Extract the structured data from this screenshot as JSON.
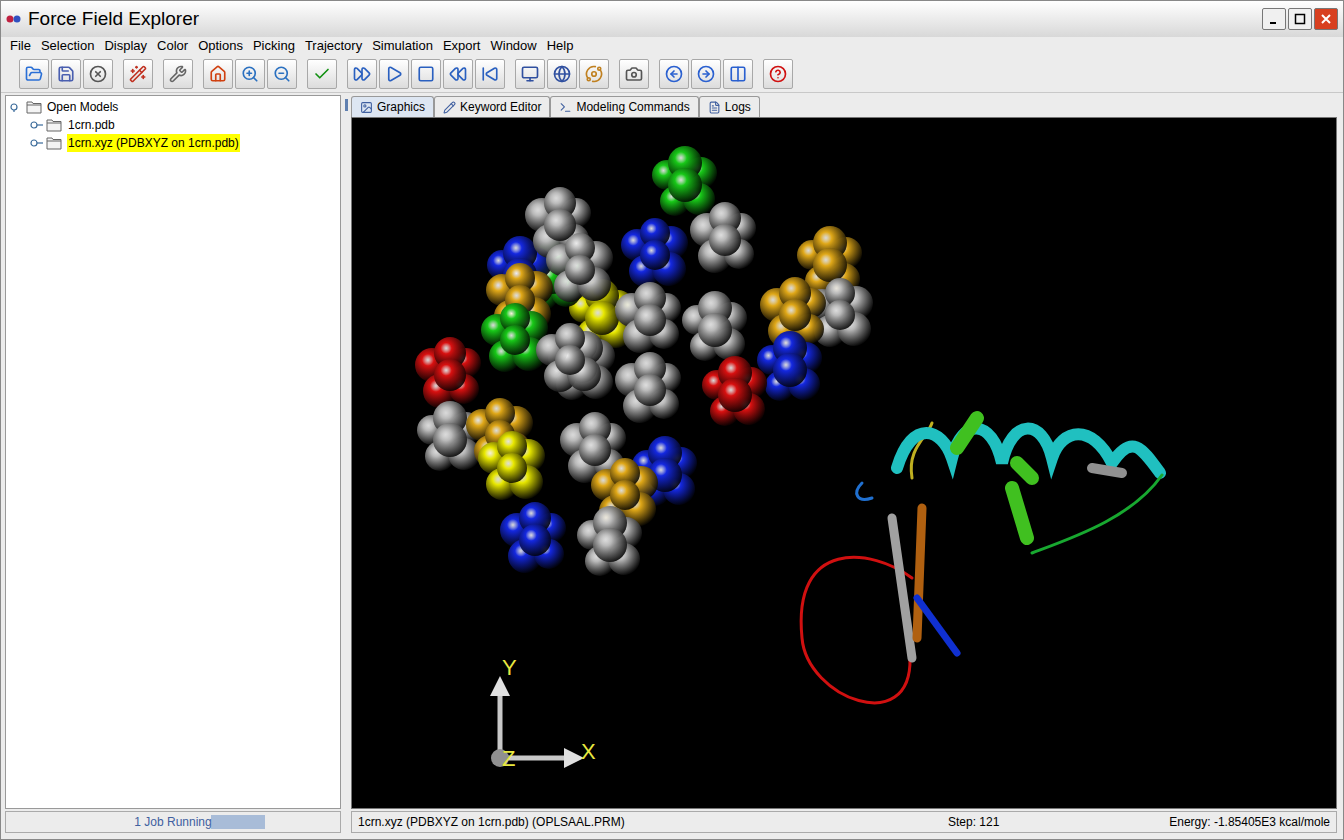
{
  "window": {
    "title": "Force Field Explorer"
  },
  "menu": [
    "File",
    "Selection",
    "Display",
    "Color",
    "Options",
    "Picking",
    "Trajectory",
    "Simulation",
    "Export",
    "Window",
    "Help"
  ],
  "tree": {
    "root": {
      "label": "Open Models",
      "expanded": true
    },
    "items": [
      {
        "label": "1crn.pdb",
        "selected": false,
        "expanded": false
      },
      {
        "label": "1crn.xyz (PDBXYZ on 1crn.pdb)",
        "selected": true,
        "expanded": false
      }
    ]
  },
  "job_status": {
    "label": "1 Job Running",
    "busy": true
  },
  "tabs": [
    {
      "label": "Graphics",
      "selected": true
    },
    {
      "label": "Keyword Editor",
      "selected": false
    },
    {
      "label": "Modeling Commands",
      "selected": false
    },
    {
      "label": "Logs",
      "selected": false
    }
  ],
  "axes": {
    "y": "Y",
    "z": "Z",
    "x": "X"
  },
  "status_bar": {
    "model": "1crn.xyz (PDBXYZ on 1crn.pdb) (OPLSAAL.PRM)",
    "step": "Step: 121",
    "energy": "Energy: -1.85405E3 kcal/mole"
  }
}
